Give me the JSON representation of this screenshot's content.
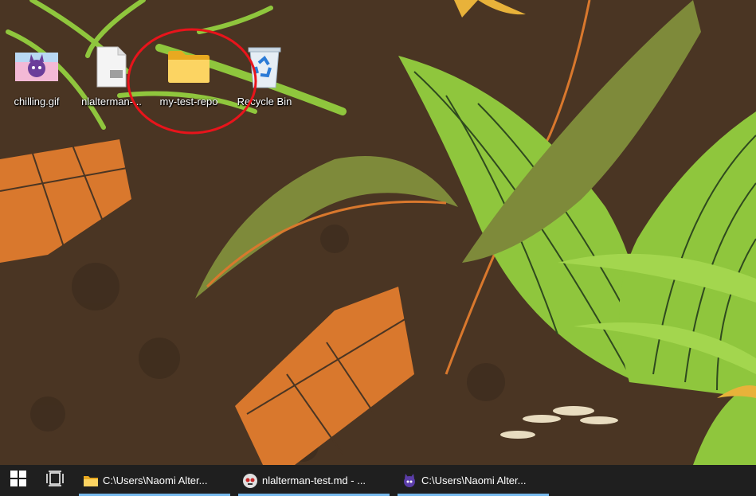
{
  "desktop": {
    "icons": [
      {
        "label": "chilling.gif",
        "icon": "gif-thumbnail-icon"
      },
      {
        "label": "nlalterman-...",
        "icon": "markdown-file-icon"
      },
      {
        "label": "my-test-repo",
        "icon": "folder-icon"
      },
      {
        "label": "Recycle Bin",
        "icon": "recycle-bin-icon"
      }
    ],
    "highlight_color": "#e8141b"
  },
  "taskbar": {
    "start_icon": "windows-start-icon",
    "task_view_icon": "task-view-icon",
    "items": [
      {
        "label": "C:\\Users\\Naomi Alter...",
        "icon": "folder-icon"
      },
      {
        "label": "nlalterman-test.md - ...",
        "icon": "markdown-editor-icon"
      },
      {
        "label": "C:\\Users\\Naomi Alter...",
        "icon": "terminal-cat-icon"
      }
    ],
    "active_underline_color": "#76b9ed"
  },
  "colors": {
    "wallpaper_base": "#4a3523",
    "leaf_green": "#8fc63d",
    "leaf_orange": "#d9782d",
    "leaf_olive": "#7e8a3a"
  }
}
